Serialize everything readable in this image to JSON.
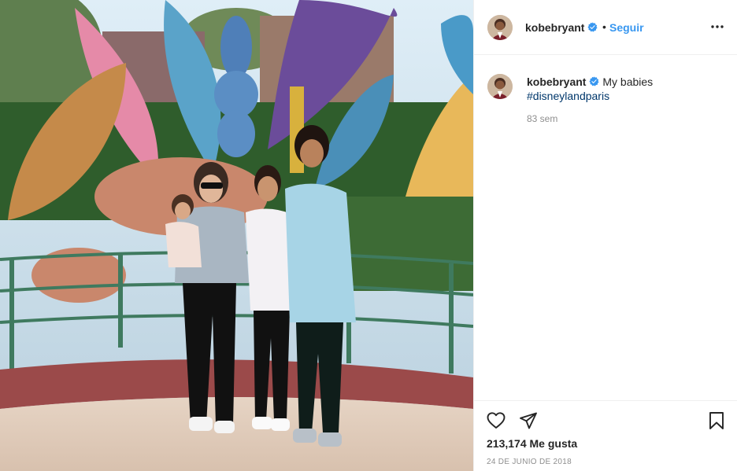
{
  "post": {
    "username": "kobebryant",
    "follow_label": "Seguir",
    "separator": "•",
    "caption": "My babies",
    "hashtag": "#disneylandparis",
    "time_ago": "83 sem",
    "likes": "213,174 Me gusta",
    "date": "24 DE JUNIO DE 2018"
  },
  "icons": {
    "verified": "verified-badge-icon",
    "more": "more-options-icon",
    "like": "heart-icon",
    "share": "share-icon",
    "save": "bookmark-icon"
  },
  "colors": {
    "accent": "#3897f0",
    "verified": "#3897f0",
    "hashtag": "#00376b",
    "muted": "#8e8e8e"
  }
}
